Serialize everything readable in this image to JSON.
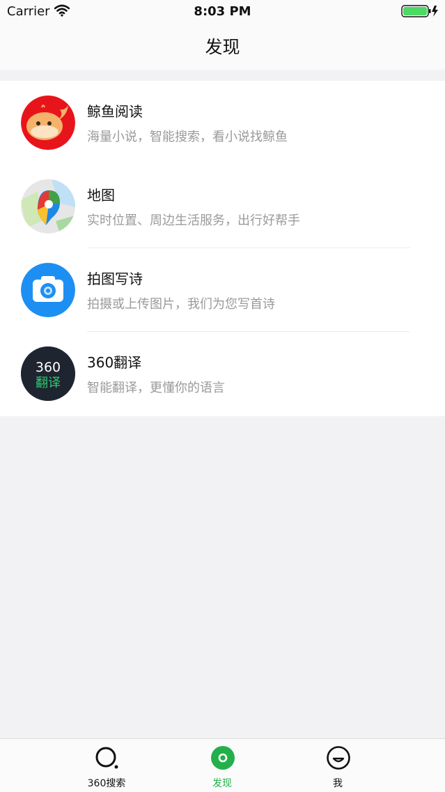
{
  "status_bar": {
    "carrier": "Carrier",
    "time": "8:03 PM"
  },
  "nav": {
    "title": "发现"
  },
  "items": [
    {
      "title": "鲸鱼阅读",
      "desc": "海量小说，智能搜索，看小说找鲸鱼",
      "icon": "whale-reading-icon"
    },
    {
      "title": "地图",
      "desc": "实时位置、周边生活服务，出行好帮手",
      "icon": "map-icon"
    },
    {
      "title": "拍图写诗",
      "desc": "拍摄或上传图片，我们为您写首诗",
      "icon": "camera-icon"
    },
    {
      "title": "360翻译",
      "desc": "智能翻译，更懂你的语言",
      "icon": "translate-icon",
      "icon_text_top": "360",
      "icon_text_bottom": "翻译"
    }
  ],
  "tabs": [
    {
      "label": "360搜索",
      "icon": "search-tab-icon",
      "active": false
    },
    {
      "label": "发现",
      "icon": "discover-tab-icon",
      "active": true
    },
    {
      "label": "我",
      "icon": "profile-tab-icon",
      "active": false
    }
  ],
  "colors": {
    "accent": "#23b04b",
    "background": "#f2f2f4",
    "secondary_text": "#9a9a9a"
  }
}
